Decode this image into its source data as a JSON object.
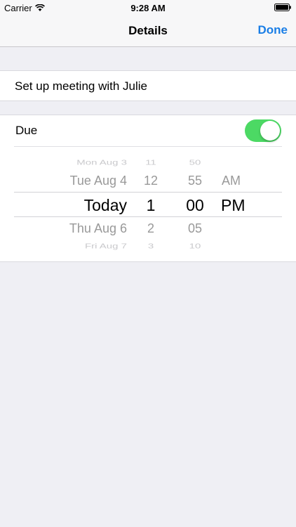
{
  "status_bar": {
    "carrier": "Carrier",
    "time": "9:28 AM"
  },
  "nav": {
    "title": "Details",
    "done_label": "Done"
  },
  "task": {
    "title": "Set up meeting with Julie"
  },
  "due": {
    "label": "Due",
    "enabled": true,
    "picker": {
      "date_column": [
        "Mon Aug 3",
        "Tue Aug 4",
        "Today",
        "Thu Aug 6",
        "Fri Aug 7"
      ],
      "hour_column": [
        "11",
        "12",
        "1",
        "2",
        "3"
      ],
      "minute_column": [
        "50",
        "55",
        "00",
        "05",
        "10"
      ],
      "ampm_column": [
        "AM",
        "PM"
      ],
      "selected": {
        "date": "Today",
        "hour": "1",
        "minute": "00",
        "ampm": "PM"
      }
    }
  },
  "colors": {
    "accent": "#1a7ee6",
    "toggle_on": "#4cd964",
    "background": "#efeff4"
  }
}
